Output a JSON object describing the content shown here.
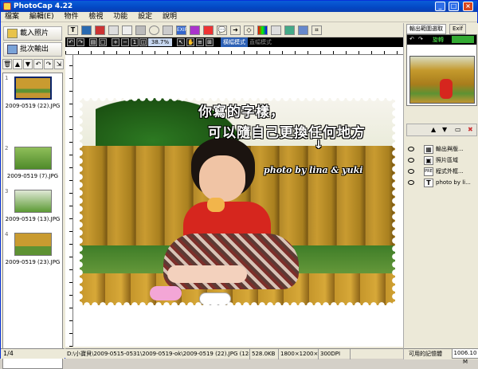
{
  "window": {
    "title": "PhotoCap 4.22"
  },
  "menu": [
    "檔案",
    "編輯(E)",
    "物件",
    "檢視",
    "功能",
    "設定",
    "說明"
  ],
  "left": {
    "load_button": "載入照片",
    "batch_button": "批次輸出",
    "thumbnails": [
      {
        "index": "1",
        "caption": "2009-0519 (22).JPG"
      },
      {
        "index": "2",
        "caption": "2009-0519 (7).JPG"
      },
      {
        "index": "3",
        "caption": "2009-0519 (13).JPG"
      },
      {
        "index": "4",
        "caption": "2009-0519 (23).JPG"
      }
    ],
    "status": "1/4"
  },
  "toolbar": {
    "zoom": "38.7%",
    "mode_active": "橫幅模式",
    "mode_inactive": "直幅模式"
  },
  "canvas": {
    "text_line1": "你寫的字樣，",
    "text_line2": "可以隨自己更換任何地方",
    "arrow": "↓",
    "credit": "photo by lina & yuki"
  },
  "status": {
    "path": "D:\\小寶貝\\2009-0515-0531\\2009-0519-ok\\2009-0519 (22).JPG (1280×960×24)",
    "size": "528.0KB",
    "dimensions": "1800×1200×24b",
    "dpi": "300DPI"
  },
  "right": {
    "tab_output": "輸出範圍選取",
    "tab_exif": "Exif",
    "rotate_label": "旋轉",
    "layers": [
      {
        "icon": "▦",
        "name": "輸出與版..."
      },
      {
        "icon": "▣",
        "name": "照片區域"
      },
      {
        "icon": "PRE",
        "name": "程式外框..."
      },
      {
        "icon": "T",
        "name": "photo by li..."
      }
    ],
    "memory_label": "可用的記憶體",
    "memory_value": "1006.10 M"
  },
  "colors": {
    "titlebar": "#0a5dd8",
    "canvas_bg": "#ffffff",
    "text_outline": "#000000"
  }
}
